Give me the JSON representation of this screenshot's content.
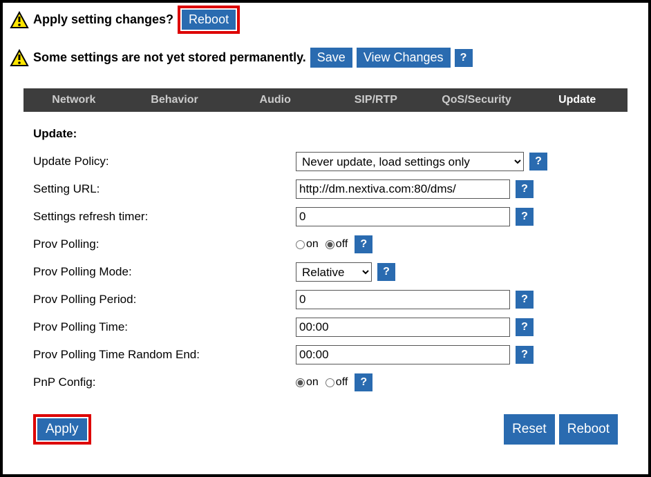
{
  "notices": {
    "apply_changes": "Apply setting changes?",
    "reboot_btn": "Reboot",
    "unsaved": "Some settings are not yet stored permanently.",
    "save_btn": "Save",
    "view_changes_btn": "View Changes",
    "help": "?"
  },
  "nav": {
    "network": "Network",
    "behavior": "Behavior",
    "audio": "Audio",
    "siprtp": "SIP/RTP",
    "qos": "QoS/Security",
    "update": "Update"
  },
  "section": {
    "title": "Update:"
  },
  "form": {
    "update_policy": {
      "label": "Update Policy:",
      "value": "Never update, load settings only"
    },
    "setting_url": {
      "label": "Setting URL:",
      "value": "http://dm.nextiva.com:80/dms/"
    },
    "refresh_timer": {
      "label": "Settings refresh timer:",
      "value": "0"
    },
    "prov_polling": {
      "label": "Prov Polling:",
      "on_label": "on",
      "off_label": "off",
      "value": "off"
    },
    "prov_polling_mode": {
      "label": "Prov Polling Mode:",
      "value": "Relative"
    },
    "prov_polling_period": {
      "label": "Prov Polling Period:",
      "value": "0"
    },
    "prov_polling_time": {
      "label": "Prov Polling Time:",
      "value": "00:00"
    },
    "prov_polling_time_random_end": {
      "label": "Prov Polling Time Random End:",
      "value": "00:00"
    },
    "pnp_config": {
      "label": "PnP Config:",
      "on_label": "on",
      "off_label": "off",
      "value": "on"
    }
  },
  "footer": {
    "apply": "Apply",
    "reset": "Reset",
    "reboot": "Reboot"
  }
}
